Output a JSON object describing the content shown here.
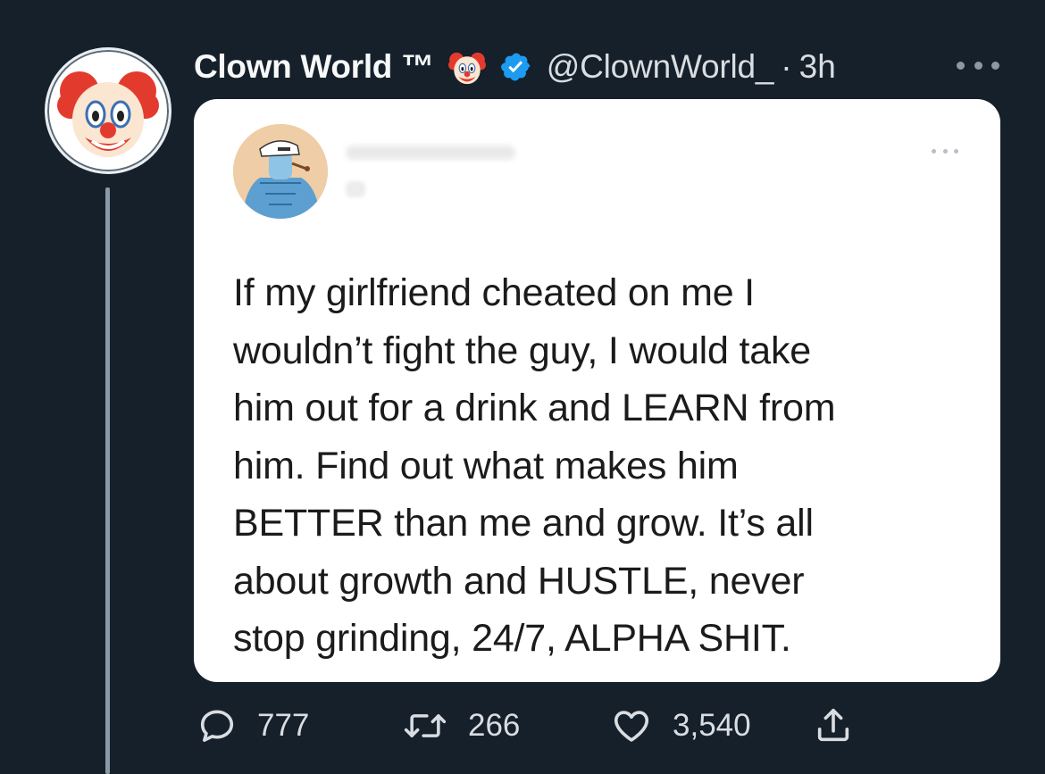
{
  "tweet": {
    "author_name": "Clown World ™",
    "handle": "@ClownWorld_",
    "separator": "·",
    "time": "3h",
    "name_emoji_icon": "clown-face-icon",
    "verified_icon": "verified-badge-icon",
    "colors": {
      "background": "#15202b",
      "verified": "#1d9bf0",
      "text_secondary": "#8b98a5"
    }
  },
  "quoted": {
    "text": "If my girlfriend cheated on me I\nwouldn’t fight the guy, I would take\nhim out for a drink and LEARN from\nhim. Find out what makes him\nBETTER than me and grow. It’s all\nabout growth and HUSTLE, never\nstop grinding, 24/7, ALPHA SHIT."
  },
  "actions": {
    "replies": "777",
    "retweets": "266",
    "likes": "3,540"
  }
}
